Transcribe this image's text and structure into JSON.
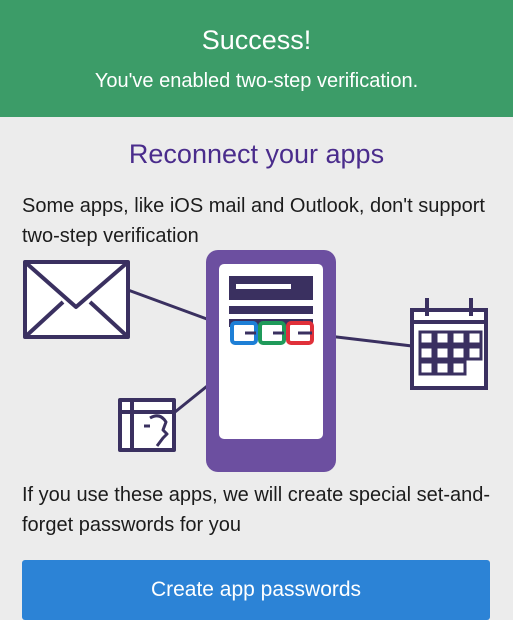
{
  "banner": {
    "title": "Success!",
    "subtitle": "You've enabled two-step verification."
  },
  "main": {
    "heading": "Reconnect your apps",
    "intro": "Some apps, like iOS mail and Outlook, don't support two-step verification",
    "note": "If you use these apps, we will create special set-and-forget passwords for you",
    "cta_label": "Create app passwords"
  },
  "illustration": {
    "icons": [
      "mail-icon",
      "phone-icon",
      "calendar-icon",
      "contacts-icon"
    ],
    "colors": {
      "stroke": "#3a3060",
      "phone": "#6c4fa0",
      "blue": "#1e7fd6",
      "green": "#1f9a5a",
      "red": "#e0303a"
    }
  },
  "colors": {
    "banner": "#3c9c68",
    "heading": "#4a2c8c",
    "button": "#2c83d6",
    "background": "#ececec"
  }
}
